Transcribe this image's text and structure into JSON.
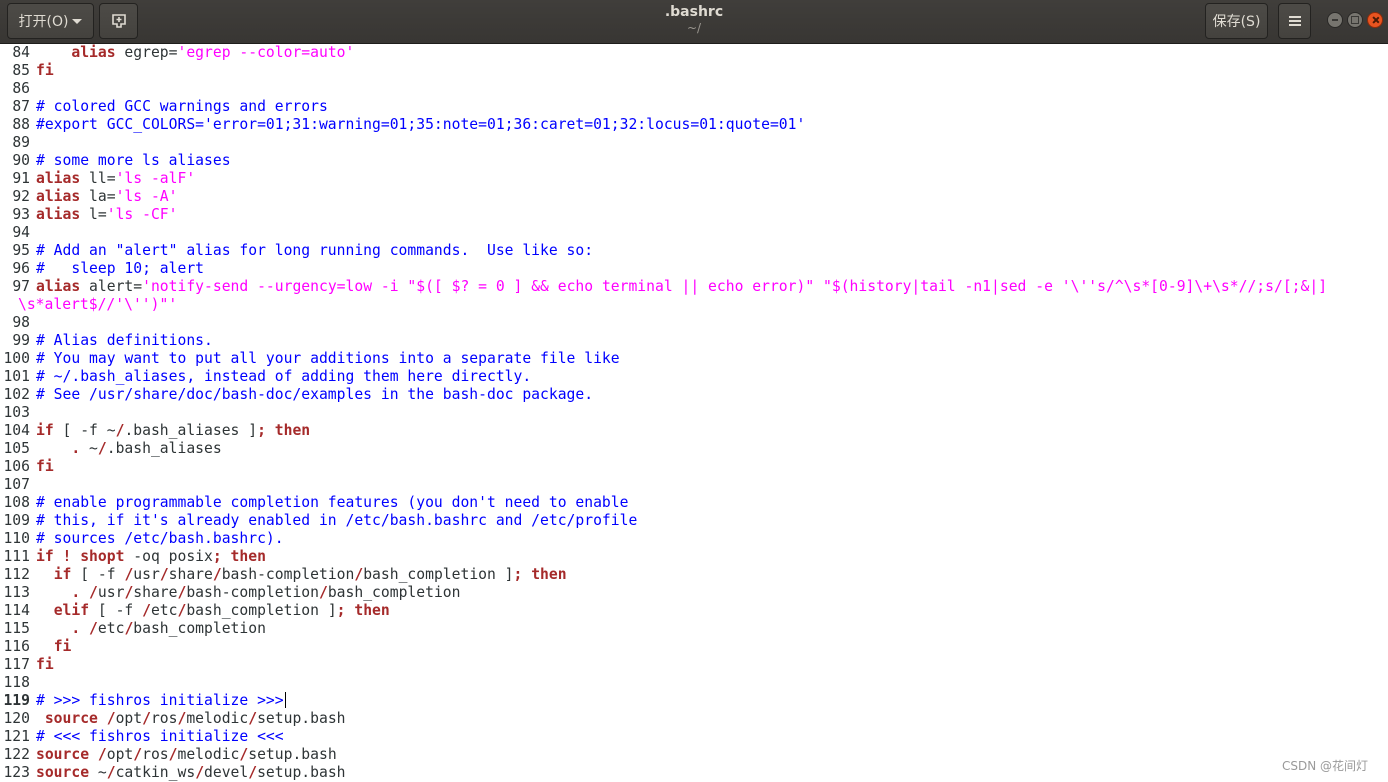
{
  "header": {
    "open_label": "打开(O)",
    "title": ".bashrc",
    "subtitle": "~/",
    "save_label": "保存(S)",
    "icons": {
      "new_document": "new-document-icon",
      "menu": "hamburger-menu-icon",
      "minimize": "minimize-icon",
      "maximize": "maximize-icon",
      "close": "close-icon"
    }
  },
  "colors": {
    "keyword": "#a52a2a",
    "comment": "#0000ff",
    "string": "#ff00ff",
    "text": "#2e3436",
    "headerbar": "#3c3b37",
    "close_button": "#e95420"
  },
  "editor": {
    "current_line": "119",
    "lines": [
      {
        "n": "84",
        "tokens": [
          [
            "tx",
            "    "
          ],
          [
            "kw",
            "alias"
          ],
          [
            "tx",
            " egrep="
          ],
          [
            "st",
            "'egrep --color=auto'"
          ]
        ]
      },
      {
        "n": "85",
        "tokens": [
          [
            "kw",
            "fi"
          ]
        ]
      },
      {
        "n": "86",
        "tokens": []
      },
      {
        "n": "87",
        "tokens": [
          [
            "cm",
            "# colored GCC warnings and errors"
          ]
        ]
      },
      {
        "n": "88",
        "tokens": [
          [
            "cm",
            "#export GCC_COLORS='error=01;31:warning=01;35:note=01;36:caret=01;32:locus=01:quote=01'"
          ]
        ]
      },
      {
        "n": "89",
        "tokens": []
      },
      {
        "n": "90",
        "tokens": [
          [
            "cm",
            "# some more ls aliases"
          ]
        ]
      },
      {
        "n": "91",
        "tokens": [
          [
            "kw",
            "alias"
          ],
          [
            "tx",
            " ll="
          ],
          [
            "st",
            "'ls -alF'"
          ]
        ]
      },
      {
        "n": "92",
        "tokens": [
          [
            "kw",
            "alias"
          ],
          [
            "tx",
            " la="
          ],
          [
            "st",
            "'ls -A'"
          ]
        ]
      },
      {
        "n": "93",
        "tokens": [
          [
            "kw",
            "alias"
          ],
          [
            "tx",
            " l="
          ],
          [
            "st",
            "'ls -CF'"
          ]
        ]
      },
      {
        "n": "94",
        "tokens": []
      },
      {
        "n": "95",
        "tokens": [
          [
            "cm",
            "# Add an \"alert\" alias for long running commands.  Use like so:"
          ]
        ]
      },
      {
        "n": "96",
        "tokens": [
          [
            "cm",
            "#   sleep 10; alert"
          ]
        ]
      },
      {
        "n": "97",
        "tokens": [
          [
            "kw",
            "alias"
          ],
          [
            "tx",
            " alert="
          ],
          [
            "st",
            "'notify-send --urgency=low -i \"$([ $? = 0 ] && echo terminal || echo error)\" \"$(history|tail -n1|sed -e '\\''s/^\\s*[0-9]\\+\\s*//;s/[;&|]"
          ]
        ]
      },
      {
        "n": "",
        "wrap": true,
        "tokens": [
          [
            "st",
            "\\s*alert$//'\\'')\"'"
          ]
        ]
      },
      {
        "n": "98",
        "tokens": []
      },
      {
        "n": "99",
        "tokens": [
          [
            "cm",
            "# Alias definitions."
          ]
        ]
      },
      {
        "n": "100",
        "tokens": [
          [
            "cm",
            "# You may want to put all your additions into a separate file like"
          ]
        ]
      },
      {
        "n": "101",
        "tokens": [
          [
            "cm",
            "# ~/.bash_aliases, instead of adding them here directly."
          ]
        ]
      },
      {
        "n": "102",
        "tokens": [
          [
            "cm",
            "# See /usr/share/doc/bash-doc/examples in the bash-doc package."
          ]
        ]
      },
      {
        "n": "103",
        "tokens": []
      },
      {
        "n": "104",
        "tokens": [
          [
            "kw",
            "if"
          ],
          [
            "tx",
            " [ -f ~"
          ],
          [
            "kw",
            "/"
          ],
          [
            "tx",
            ".bash_aliases ]"
          ],
          [
            "kw",
            "; then"
          ]
        ]
      },
      {
        "n": "105",
        "tokens": [
          [
            "tx",
            "    "
          ],
          [
            "kw",
            "."
          ],
          [
            "tx",
            " ~"
          ],
          [
            "kw",
            "/"
          ],
          [
            "tx",
            ".bash_aliases"
          ]
        ]
      },
      {
        "n": "106",
        "tokens": [
          [
            "kw",
            "fi"
          ]
        ]
      },
      {
        "n": "107",
        "tokens": []
      },
      {
        "n": "108",
        "tokens": [
          [
            "cm",
            "# enable programmable completion features (you don't need to enable"
          ]
        ]
      },
      {
        "n": "109",
        "tokens": [
          [
            "cm",
            "# this, if it's already enabled in /etc/bash.bashrc and /etc/profile"
          ]
        ]
      },
      {
        "n": "110",
        "tokens": [
          [
            "cm",
            "# sources /etc/bash.bashrc)."
          ]
        ]
      },
      {
        "n": "111",
        "tokens": [
          [
            "kw",
            "if ! shopt"
          ],
          [
            "tx",
            " -oq posix"
          ],
          [
            "kw",
            "; then"
          ]
        ]
      },
      {
        "n": "112",
        "tokens": [
          [
            "tx",
            "  "
          ],
          [
            "kw",
            "if"
          ],
          [
            "tx",
            " [ -f "
          ],
          [
            "kw",
            "/"
          ],
          [
            "tx",
            "usr"
          ],
          [
            "kw",
            "/"
          ],
          [
            "tx",
            "share"
          ],
          [
            "kw",
            "/"
          ],
          [
            "tx",
            "bash-completion"
          ],
          [
            "kw",
            "/"
          ],
          [
            "tx",
            "bash_completion ]"
          ],
          [
            "kw",
            "; then"
          ]
        ]
      },
      {
        "n": "113",
        "tokens": [
          [
            "tx",
            "    "
          ],
          [
            "kw",
            ". /"
          ],
          [
            "tx",
            "usr"
          ],
          [
            "kw",
            "/"
          ],
          [
            "tx",
            "share"
          ],
          [
            "kw",
            "/"
          ],
          [
            "tx",
            "bash-completion"
          ],
          [
            "kw",
            "/"
          ],
          [
            "tx",
            "bash_completion"
          ]
        ]
      },
      {
        "n": "114",
        "tokens": [
          [
            "tx",
            "  "
          ],
          [
            "kw",
            "elif"
          ],
          [
            "tx",
            " [ -f "
          ],
          [
            "kw",
            "/"
          ],
          [
            "tx",
            "etc"
          ],
          [
            "kw",
            "/"
          ],
          [
            "tx",
            "bash_completion ]"
          ],
          [
            "kw",
            "; then"
          ]
        ]
      },
      {
        "n": "115",
        "tokens": [
          [
            "tx",
            "    "
          ],
          [
            "kw",
            ". /"
          ],
          [
            "tx",
            "etc"
          ],
          [
            "kw",
            "/"
          ],
          [
            "tx",
            "bash_completion"
          ]
        ]
      },
      {
        "n": "116",
        "tokens": [
          [
            "tx",
            "  "
          ],
          [
            "kw",
            "fi"
          ]
        ]
      },
      {
        "n": "117",
        "tokens": [
          [
            "kw",
            "fi"
          ]
        ]
      },
      {
        "n": "118",
        "tokens": []
      },
      {
        "n": "119",
        "cursor": true,
        "tokens": [
          [
            "cm",
            "# >>> fishros initialize >>>"
          ]
        ]
      },
      {
        "n": "120",
        "tokens": [
          [
            "tx",
            " "
          ],
          [
            "kw",
            "source /"
          ],
          [
            "tx",
            "opt"
          ],
          [
            "kw",
            "/"
          ],
          [
            "tx",
            "ros"
          ],
          [
            "kw",
            "/"
          ],
          [
            "tx",
            "melodic"
          ],
          [
            "kw",
            "/"
          ],
          [
            "tx",
            "setup.bash"
          ]
        ]
      },
      {
        "n": "121",
        "tokens": [
          [
            "cm",
            "# <<< fishros initialize <<<"
          ]
        ]
      },
      {
        "n": "122",
        "tokens": [
          [
            "kw",
            "source /"
          ],
          [
            "tx",
            "opt"
          ],
          [
            "kw",
            "/"
          ],
          [
            "tx",
            "ros"
          ],
          [
            "kw",
            "/"
          ],
          [
            "tx",
            "melodic"
          ],
          [
            "kw",
            "/"
          ],
          [
            "tx",
            "setup.bash"
          ]
        ]
      },
      {
        "n": "123",
        "tokens": [
          [
            "kw",
            "source"
          ],
          [
            "tx",
            " ~"
          ],
          [
            "kw",
            "/"
          ],
          [
            "tx",
            "catkin_ws"
          ],
          [
            "kw",
            "/"
          ],
          [
            "tx",
            "devel"
          ],
          [
            "kw",
            "/"
          ],
          [
            "tx",
            "setup.bash"
          ]
        ]
      }
    ]
  },
  "watermark": "CSDN @花间灯"
}
